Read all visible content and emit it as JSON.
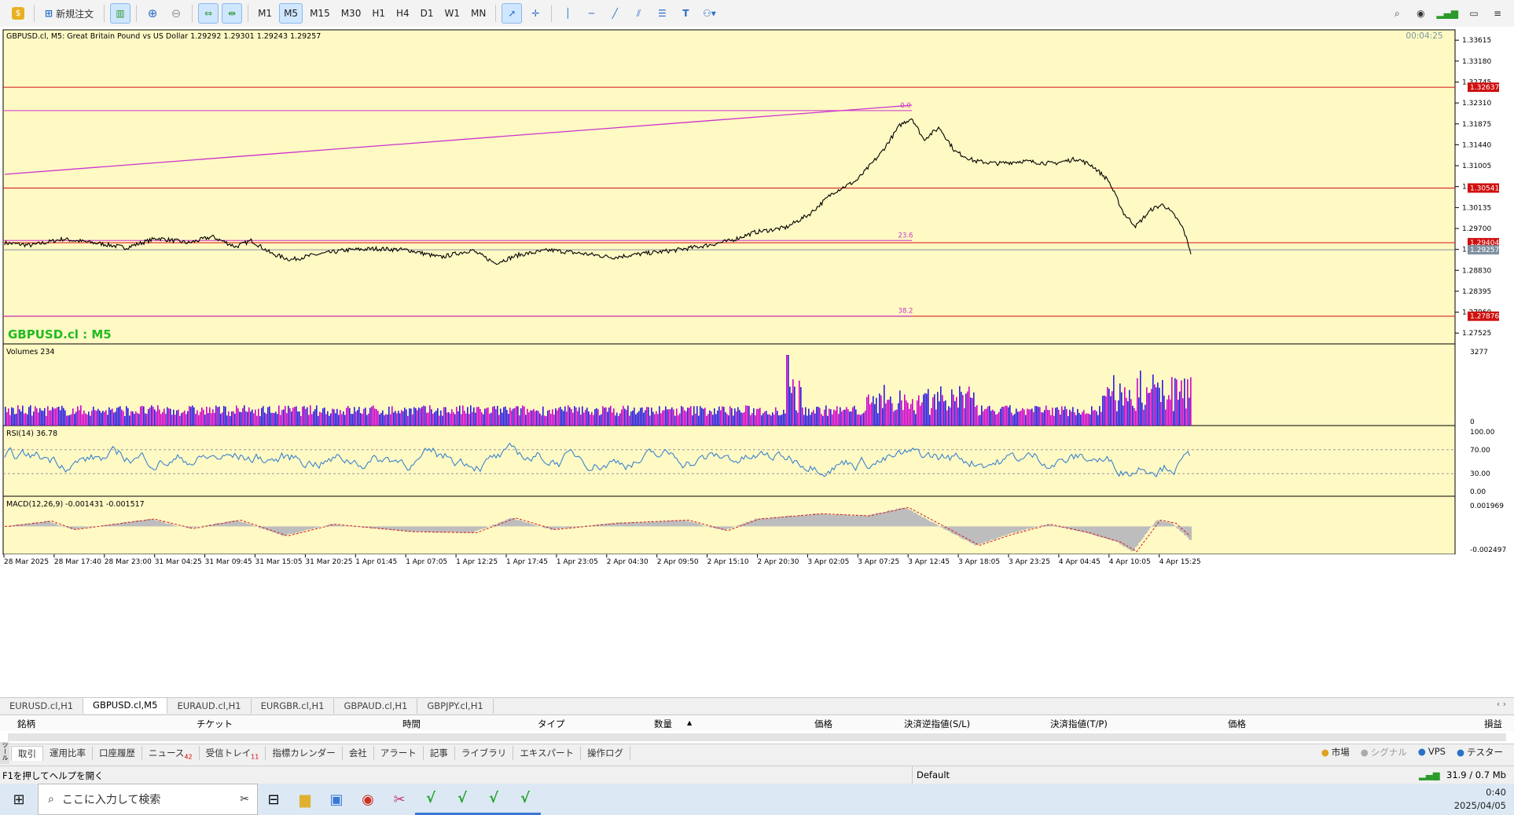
{
  "toolbar": {
    "new_order_label": "新規注文",
    "timeframes": [
      "M1",
      "M5",
      "M15",
      "M30",
      "H1",
      "H4",
      "D1",
      "W1",
      "MN"
    ],
    "active_timeframe": "M5"
  },
  "chart": {
    "info_line": "GBPUSD.cl, M5:  Great Britain Pound vs US Dollar  1.29292 1.29301 1.29243 1.29257",
    "countdown": "00:04:25",
    "symbol_label": "GBPUSD.cl : M5",
    "symbol_label_color": "#22bb22",
    "price_ticks": [
      "1.33615",
      "1.33180",
      "1.32745",
      "1.32310",
      "1.31875",
      "1.31440",
      "1.31005",
      "1.30570",
      "1.30135",
      "1.29700",
      "1.29265",
      "1.28830",
      "1.28395",
      "1.27960",
      "1.27525"
    ],
    "hline_labels": [
      {
        "text": "1.32637",
        "price": 1.32637,
        "color": "#d01010"
      },
      {
        "text": "1.30541",
        "price": 1.30541,
        "color": "#d01010"
      },
      {
        "text": "1.29404",
        "price": 1.29404,
        "color": "#d01010"
      },
      {
        "text": "1.29257",
        "price": 1.29257,
        "color": "#8090a0"
      },
      {
        "text": "1.27876",
        "price": 1.27876,
        "color": "#d01010"
      }
    ],
    "fib_labels": [
      {
        "text": "0.0",
        "price": 1.3215
      },
      {
        "text": "23.6",
        "price": 1.2945
      },
      {
        "text": "38.2",
        "price": 1.2788
      }
    ],
    "volumes_label": "Volumes 234",
    "volume_ticks": [
      "3277",
      "0"
    ],
    "rsi_label": "RSI(14) 36.78",
    "rsi_ticks": [
      "100.00",
      "70.00",
      "30.00",
      "0.00"
    ],
    "macd_label": "MACD(12,26,9) -0.001431 -0.001517",
    "macd_ticks": [
      "0.001969",
      "-0.002497"
    ],
    "time_labels": [
      "28 Mar 2025",
      "28 Mar 17:40",
      "28 Mar 23:00",
      "31 Mar 04:25",
      "31 Mar 09:45",
      "31 Mar 15:05",
      "31 Mar 20:25",
      "1 Apr 01:45",
      "1 Apr 07:05",
      "1 Apr 12:25",
      "1 Apr 17:45",
      "1 Apr 23:05",
      "2 Apr 04:30",
      "2 Apr 09:50",
      "2 Apr 15:10",
      "2 Apr 20:30",
      "3 Apr 02:05",
      "3 Apr 07:25",
      "3 Apr 12:45",
      "3 Apr 18:05",
      "3 Apr 23:25",
      "4 Apr 04:45",
      "4 Apr 10:05",
      "4 Apr 15:25"
    ]
  },
  "chart_tabs": [
    "EURUSD.cl,H1",
    "GBPUSD.cl,M5",
    "EURAUD.cl,H1",
    "EURGBR.cl,H1",
    "GBPAUD.cl,H1",
    "GBPJPY.cl,H1"
  ],
  "active_chart_tab": "GBPUSD.cl,M5",
  "terminal": {
    "columns": [
      "銘柄",
      "チケット",
      "時間",
      "タイプ",
      "数量",
      "価格",
      "決済逆指値(S/L)",
      "決済指値(T/P)",
      "価格",
      "損益"
    ]
  },
  "bottom_tabs": [
    {
      "label": "取引",
      "badge": ""
    },
    {
      "label": "運用比率",
      "badge": ""
    },
    {
      "label": "口座履歴",
      "badge": ""
    },
    {
      "label": "ニュース",
      "badge": "42"
    },
    {
      "label": "受信トレイ",
      "badge": "11"
    },
    {
      "label": "指標カレンダー",
      "badge": ""
    },
    {
      "label": "会社",
      "badge": ""
    },
    {
      "label": "アラート",
      "badge": ""
    },
    {
      "label": "記事",
      "badge": ""
    },
    {
      "label": "ライブラリ",
      "badge": ""
    },
    {
      "label": "エキスパート",
      "badge": ""
    },
    {
      "label": "操作ログ",
      "badge": ""
    }
  ],
  "bottom_right": [
    "市場",
    "シグナル",
    "VPS",
    "テスター"
  ],
  "side_label": "ツールボックス",
  "status": {
    "help": "F1を押してヘルプを開く",
    "profile": "Default",
    "connection": "31.9 / 0.7 Mb"
  },
  "taskbar": {
    "search_placeholder": "ここに入力して検索",
    "time": "0:40",
    "date": "2025/04/05"
  }
}
